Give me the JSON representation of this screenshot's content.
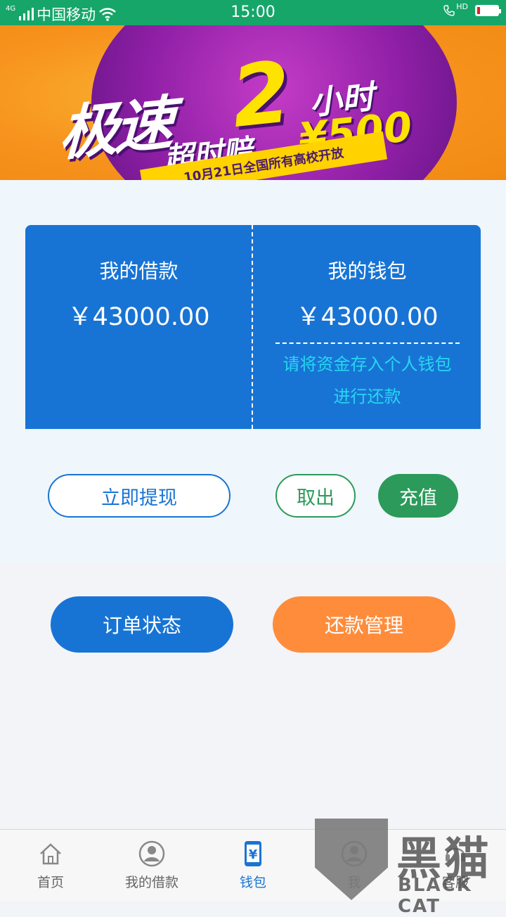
{
  "status_bar": {
    "network": "4G",
    "carrier": "中国移动",
    "time": "15:00",
    "call_indicator": "HD",
    "battery_level": 0.15
  },
  "banner": {
    "big_text": "极速",
    "number": "2",
    "unit": "小时",
    "compensation": "超时赔",
    "amount": "¥500",
    "ribbon": "10月21日全国所有高校开放"
  },
  "card": {
    "loan_title": "我的借款",
    "loan_value": "￥43000.00",
    "wallet_title": "我的钱包",
    "wallet_value": "￥43000.00",
    "hint_line1": "请将资金存入个人钱包",
    "hint_line2": "进行还款"
  },
  "actions": {
    "withdraw_now": "立即提现",
    "take_out": "取出",
    "recharge": "充值",
    "order_status": "订单状态",
    "repay_manage": "还款管理"
  },
  "tabbar": {
    "items": [
      {
        "label": "首页",
        "icon": "home-icon"
      },
      {
        "label": "我的借款",
        "icon": "person-circle-icon"
      },
      {
        "label": "钱包",
        "icon": "wallet-icon",
        "active": true
      },
      {
        "label": "我",
        "icon": "user-icon"
      },
      {
        "label": "客服",
        "icon": "service-icon"
      }
    ]
  },
  "watermark": {
    "text_cn": "黑猫",
    "text_en": "BLACK CAT"
  },
  "colors": {
    "status_bar": "#16a66a",
    "primary_blue": "#1874d4",
    "green": "#2b9a5a",
    "orange": "#ff8c3b",
    "hint_cyan": "#26d7f1"
  }
}
